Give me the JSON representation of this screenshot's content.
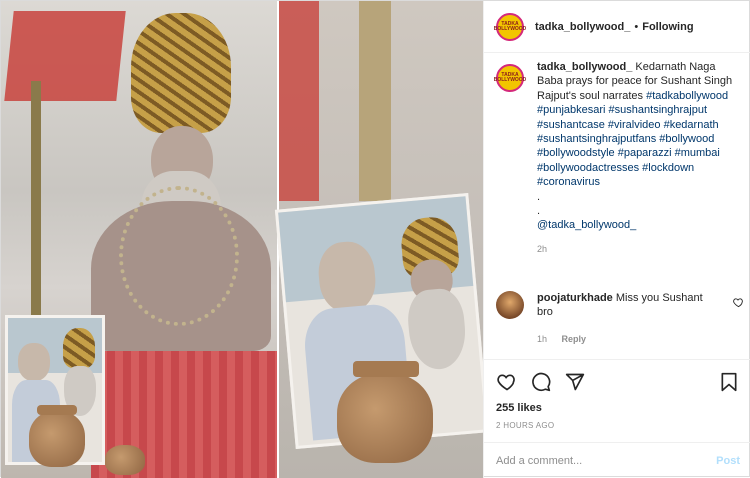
{
  "header": {
    "username": "tadka_bollywood_",
    "separator": "•",
    "follow_status": "Following",
    "logo_text": "TADKA BOLLYWOOD"
  },
  "caption": {
    "username": "tadka_bollywood_",
    "text": "Kedarnath Naga Baba prays for peace for Sushant Singh Rajput's soul narrates",
    "hashtags": "#tadkabollywood #punjabkesari #sushantsinghrajput #sushantcase #viralvideo #kedarnath #sushantsinghrajputfans #bollywood #bollywoodstyle #paparazzi #mumbai #bollywoodactresses #lockdown #coronavirus",
    "dot1": ".",
    "dot2": ".",
    "mention": "@tadka_bollywood_",
    "time": "2h"
  },
  "comment": {
    "username": "poojaturkhade",
    "text": "Miss you Sushant bro",
    "time": "1h",
    "reply_label": "Reply",
    "icon": "heart-icon"
  },
  "actions": {
    "icons": [
      "heart-icon",
      "comment-icon",
      "share-icon",
      "bookmark-icon"
    ],
    "likes": "255 likes",
    "post_time": "2 HOURS AGO"
  },
  "add_comment": {
    "placeholder": "Add a comment...",
    "post_label": "Post"
  },
  "colors": {
    "link": "#00376b",
    "muted": "#8e8e8e",
    "post_disabled": "#b2dffc",
    "logo_yellow": "#f2c500"
  }
}
